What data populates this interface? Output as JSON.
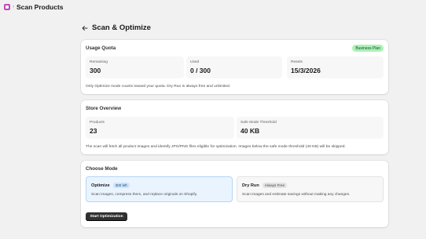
{
  "topbar": {
    "separator": "›",
    "title": "Scan Products"
  },
  "page": {
    "title": "Scan & Optimize"
  },
  "usage_quota": {
    "title": "Usage Quota",
    "plan_badge": "Business Plan",
    "stats": [
      {
        "label": "Remaining",
        "value": "300"
      },
      {
        "label": "Used",
        "value": "0 / 300"
      },
      {
        "label": "Resets",
        "value": "15/3/2026"
      }
    ],
    "note": "Only Optimize mode counts toward your quota. Dry Run is always free and unlimited."
  },
  "store_overview": {
    "title": "Store Overview",
    "stats": [
      {
        "label": "Products",
        "value": "23"
      },
      {
        "label": "Safe Mode Threshold",
        "value": "40 KB"
      }
    ],
    "note": "The scan will fetch all product images and identify JPG/PNG files eligible for optimization. Images below the safe mode threshold (40 KB) will be skipped."
  },
  "choose_mode": {
    "title": "Choose Mode",
    "modes": [
      {
        "name": "Optimize",
        "tag": "300 left",
        "description": "Scan images, compress them, and replace originals on Shopify."
      },
      {
        "name": "Dry Run",
        "tag": "Always Free",
        "description": "Scan images and estimate savings without making any changes."
      }
    ],
    "start_button": "Start Optimization"
  },
  "colors": {
    "app_icon": "#c44ab8",
    "plan_badge_bg": "#aff0b5",
    "selected_mode_bg": "#eaf4ff",
    "primary_button": "#303030"
  },
  "icons": {
    "app": "app-icon",
    "back": "arrow-left-icon"
  }
}
